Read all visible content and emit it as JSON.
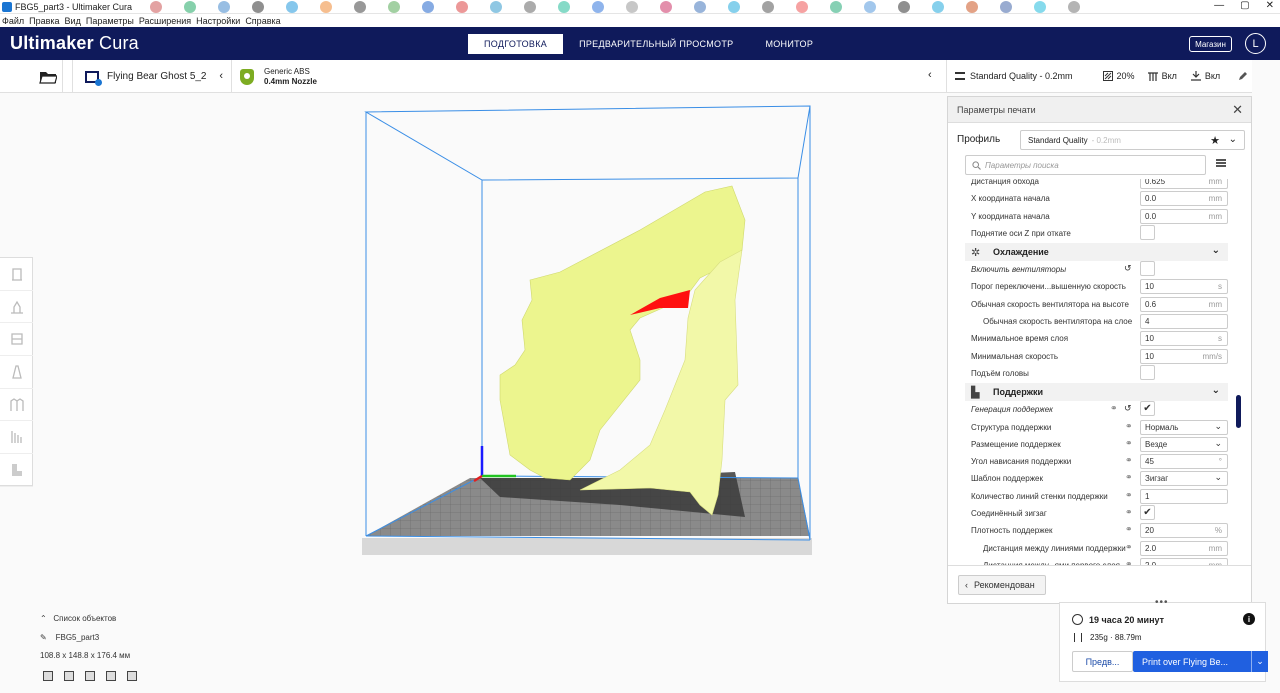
{
  "window": {
    "title": "FBG5_part3 - Ultimaker Cura",
    "controls": [
      "—",
      "▢",
      "✕"
    ]
  },
  "menu": [
    "Файл",
    "Правка",
    "Вид",
    "Параметры",
    "Расширения",
    "Настройки",
    "Справка"
  ],
  "header": {
    "brand_bold": "Ultimaker",
    "brand_light": "Cura",
    "stages": [
      "ПОДГОТОВКА",
      "ПРЕДВАРИТЕЛЬНЫЙ ПРОСМОТР",
      "МОНИТОР"
    ],
    "active_stage": 0,
    "marketplace": "Магазин",
    "avatar_letter": "L"
  },
  "toolbar": {
    "printer_name": "Flying Bear Ghost 5_2",
    "material_name": "Generic ABS",
    "nozzle": "0.4mm Nozzle",
    "quality": "Standard Quality - 0.2mm",
    "infill": "20%",
    "support": "Вкл",
    "adhesion": "Вкл"
  },
  "print_settings": {
    "title": "Параметры печати",
    "profile_label": "Профиль",
    "profile_value": "Standard Quality",
    "profile_suffix": "- 0.2mm",
    "search_placeholder": "Параметры поиска",
    "rows": [
      {
        "kind": "input",
        "label": "Дистанция обхода",
        "value": "0.625",
        "unit": "mm",
        "indent": false,
        "italic": false,
        "link": false,
        "reset": false
      },
      {
        "kind": "input",
        "label": "X координата начала",
        "value": "0.0",
        "unit": "mm",
        "indent": false,
        "italic": false,
        "link": false,
        "reset": false
      },
      {
        "kind": "input",
        "label": "Y координата начала",
        "value": "0.0",
        "unit": "mm",
        "indent": false,
        "italic": false,
        "link": false,
        "reset": false
      },
      {
        "kind": "check",
        "label": "Поднятие оси Z при откате",
        "checked": false,
        "indent": false,
        "italic": false,
        "link": false,
        "reset": false
      },
      {
        "kind": "category",
        "label": "Охлаждение",
        "icon": "fan-icon"
      },
      {
        "kind": "check",
        "label": "Включить вентиляторы",
        "checked": false,
        "indent": false,
        "italic": true,
        "link": false,
        "reset": true
      },
      {
        "kind": "input",
        "label": "Порог переключени...вышенную скорость",
        "value": "10",
        "unit": "s",
        "indent": false,
        "italic": false,
        "link": false,
        "reset": false
      },
      {
        "kind": "input",
        "label": "Обычная скорость вентилятора на высоте",
        "value": "0.6",
        "unit": "mm",
        "indent": false,
        "italic": false,
        "link": false,
        "reset": false
      },
      {
        "kind": "input",
        "label": "Обычная скорость вентилятора на слое",
        "value": "4",
        "unit": "",
        "indent": true,
        "italic": false,
        "link": false,
        "reset": false
      },
      {
        "kind": "input",
        "label": "Минимальное время слоя",
        "value": "10",
        "unit": "s",
        "indent": false,
        "italic": false,
        "link": false,
        "reset": false
      },
      {
        "kind": "input",
        "label": "Минимальная скорость",
        "value": "10",
        "unit": "mm/s",
        "indent": false,
        "italic": false,
        "link": false,
        "reset": false
      },
      {
        "kind": "check",
        "label": "Подъём головы",
        "checked": false,
        "indent": false,
        "italic": false,
        "link": false,
        "reset": false
      },
      {
        "kind": "category",
        "label": "Поддержки",
        "icon": "support-icon"
      },
      {
        "kind": "check",
        "label": "Генерация поддержек",
        "checked": true,
        "indent": false,
        "italic": true,
        "link": true,
        "reset": true
      },
      {
        "kind": "select",
        "label": "Структура поддержки",
        "value": "Нормаль",
        "indent": false,
        "italic": false,
        "link": true,
        "reset": false
      },
      {
        "kind": "select",
        "label": "Размещение поддержек",
        "value": "Везде",
        "indent": false,
        "italic": false,
        "link": true,
        "reset": false
      },
      {
        "kind": "input",
        "label": "Угол нависания поддержки",
        "value": "45",
        "unit": "°",
        "indent": false,
        "italic": false,
        "link": true,
        "reset": false
      },
      {
        "kind": "select",
        "label": "Шаблон поддержек",
        "value": "Зигзаг",
        "indent": false,
        "italic": false,
        "link": true,
        "reset": false
      },
      {
        "kind": "input",
        "label": "Количество линий стенки поддержки",
        "value": "1",
        "unit": "",
        "indent": false,
        "italic": false,
        "link": true,
        "reset": false
      },
      {
        "kind": "check",
        "label": "Соединённый зигзаг",
        "checked": true,
        "indent": false,
        "italic": false,
        "link": true,
        "reset": false
      },
      {
        "kind": "input",
        "label": "Плотность поддержек",
        "value": "20",
        "unit": "%",
        "indent": false,
        "italic": false,
        "link": true,
        "reset": false
      },
      {
        "kind": "input",
        "label": "Дистанция между линиями поддержки",
        "value": "2.0",
        "unit": "mm",
        "indent": true,
        "italic": false,
        "link": true,
        "reset": false
      },
      {
        "kind": "input",
        "label": "Дистанция между...ями первого слоя",
        "value": "2.0",
        "unit": "mm",
        "indent": true,
        "italic": false,
        "link": true,
        "reset": false
      }
    ],
    "recommended_button": "Рекомендован"
  },
  "objects": {
    "header": "Список объектов",
    "name": "FBG5_part3",
    "dimensions": "108.8 x 148.8 x 176.4 мм"
  },
  "print_panel": {
    "time": "19 часа 20 минут",
    "material_usage": "235g · 88.79m",
    "preview_button": "Предв...",
    "print_button": "Print over Flying Be..."
  },
  "colors": {
    "header_bg": "#0f1a5b",
    "model": "#ecf58e",
    "overhang": "#ff1010",
    "build_volume": "#3a8ee6",
    "primary_button": "#2060e0"
  }
}
